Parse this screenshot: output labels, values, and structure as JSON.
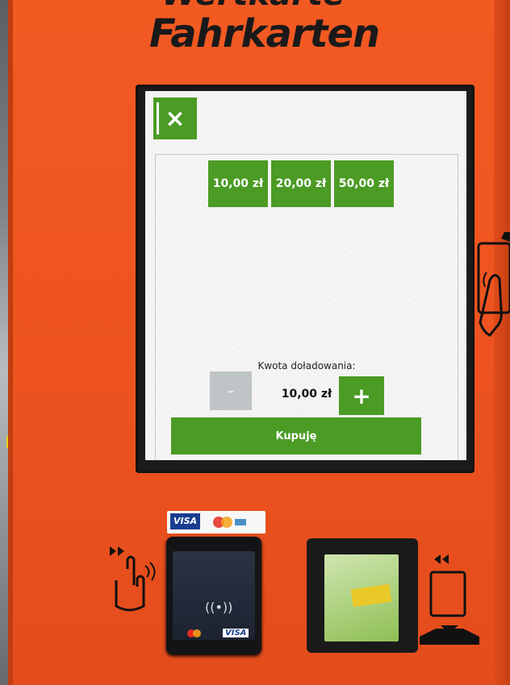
{
  "header": {
    "top_line": "Wertkarte",
    "title": "Fahrkarten"
  },
  "screen": {
    "close_label": "×",
    "amount_options": [
      "10,00 zł",
      "20,00 zł",
      "50,00 zł"
    ],
    "topup_label": "Kwota doładowania:",
    "minus_label": "-",
    "current_amount": "10,00 zł",
    "plus_label": "+",
    "buy_label": "Kupuję"
  },
  "hardware": {
    "card_brand": "VISA",
    "reader_brand": "VISA",
    "contactless_symbol": "((•))"
  },
  "colors": {
    "machine_orange": "#ef5420",
    "button_green": "#4b9b24",
    "disabled_gray": "#bfc4c6"
  }
}
